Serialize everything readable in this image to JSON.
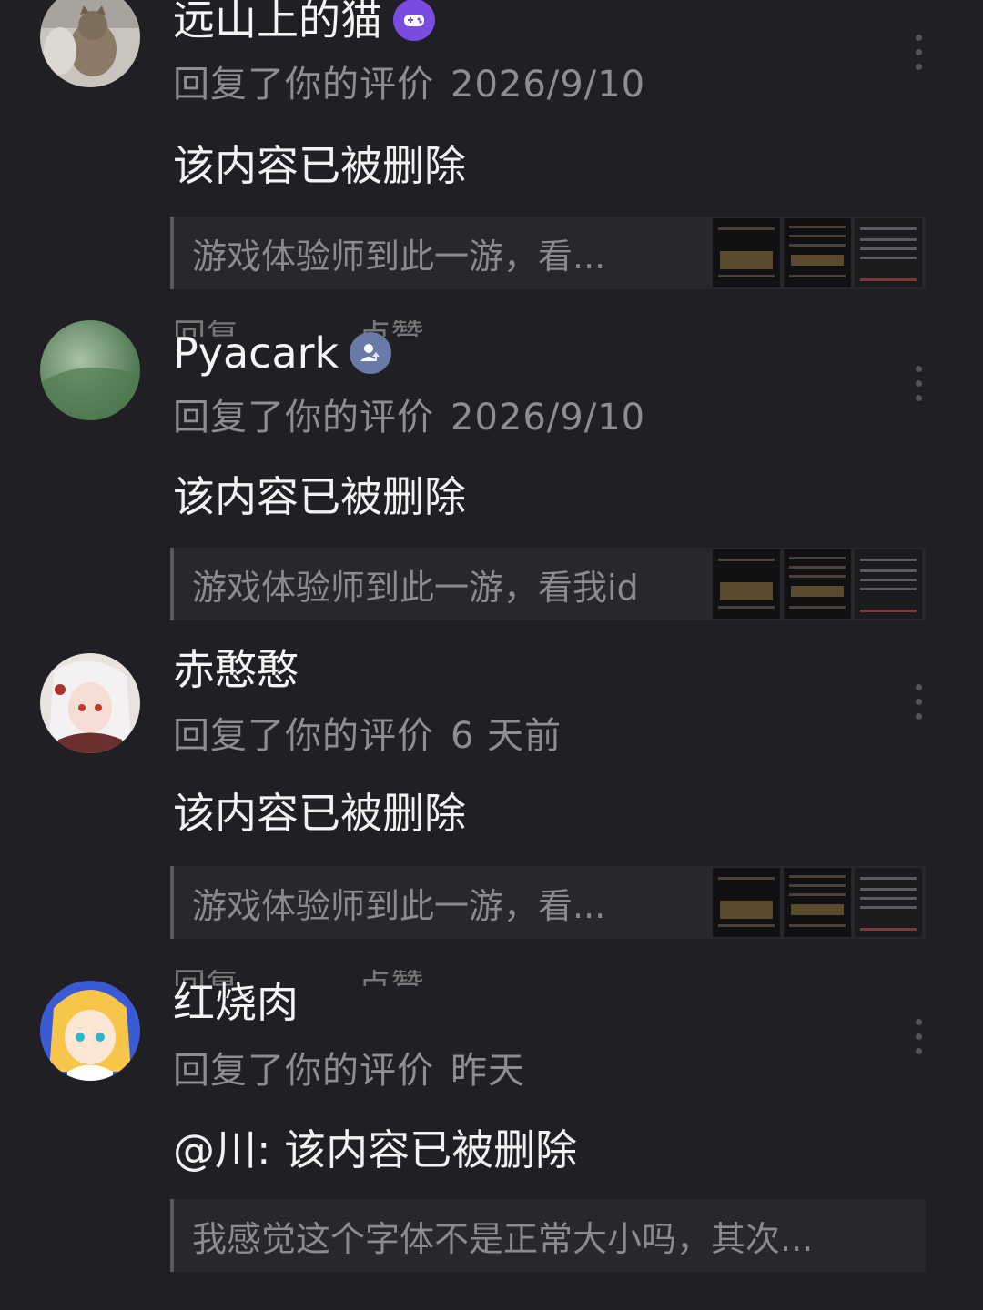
{
  "comments": [
    {
      "name": "远山上的猫",
      "meta_label": "回复了你的评价",
      "time": "2026/9/10",
      "content": "该内容已被删除",
      "quote": "游戏体验师到此一游，看...",
      "badge_color": "#7b4ce0"
    },
    {
      "name": "Pyacark",
      "meta_label": "回复了你的评价",
      "time": "2026/9/10",
      "content": "该内容已被删除",
      "quote": "游戏体验师到此一游，看我id",
      "badge_color": "#6a7aa8"
    },
    {
      "name": "赤憨憨",
      "meta_label": "回复了你的评价",
      "time": "6 天前",
      "content": "该内容已被删除",
      "quote": "游戏体验师到此一游，看..."
    },
    {
      "name": "红烧肉",
      "meta_label": "回复了你的评价",
      "time": "昨天",
      "content": "@川: 该内容已被删除",
      "quote": "我感觉这个字体不是正常大小吗，其次..."
    }
  ],
  "actions": {
    "reply": "回复",
    "like": "点赞"
  },
  "icons": {
    "more": "more-dots-icon",
    "badge_game": "gamepad-icon",
    "badge_user": "user-up-icon"
  }
}
